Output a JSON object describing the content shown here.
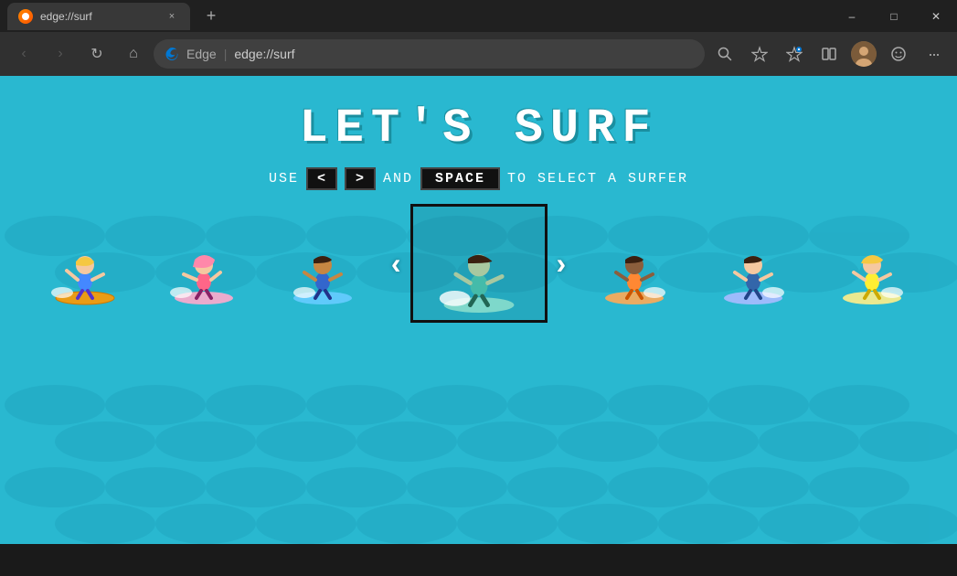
{
  "browser": {
    "tab": {
      "favicon_color": "#f60",
      "title": "edge://surf",
      "close_label": "×"
    },
    "new_tab_label": "+",
    "nav": {
      "back_label": "‹",
      "forward_label": "›",
      "refresh_label": "↺",
      "home_label": "⌂",
      "address_brand": "Edge",
      "address_separator": "|",
      "address_url": "edge://surf",
      "search_label": "🔍",
      "favorite_label": "☆",
      "collections_label": "☆",
      "split_label": "⧉",
      "profile_label": "👤",
      "emoji_label": "☺",
      "more_label": "···"
    }
  },
  "game": {
    "title": "LET'S SURF",
    "instruction": {
      "prefix": "USE",
      "left_key": "<",
      "right_key": ">",
      "middle": "AND",
      "space_key": "SPACE",
      "suffix": "TO SELECT A SURFER"
    },
    "surfers": [
      {
        "id": 1,
        "description": "blonde-girl",
        "selected": false,
        "hair": "#f5c842",
        "skin": "#f5c8a0",
        "shirt": "#4488ff",
        "pants": "#5533cc"
      },
      {
        "id": 2,
        "description": "pink-hair-girl",
        "selected": false,
        "hair": "#ff88aa",
        "skin": "#f5c8a0",
        "shirt": "#ff6688",
        "pants": "#882266"
      },
      {
        "id": 3,
        "description": "blue-shirt-girl",
        "selected": false,
        "hair": "#3a2010",
        "skin": "#c68642",
        "shirt": "#3366cc",
        "pants": "#22338a"
      },
      {
        "id": 4,
        "description": "teal-shirt-girl",
        "selected": true,
        "hair": "#3a2010",
        "skin": "#a0c8a0",
        "shirt": "#44bbaa",
        "pants": "#226655"
      },
      {
        "id": 5,
        "description": "orange-shirt-boy",
        "selected": false,
        "hair": "#3a2010",
        "skin": "#8b5e3c",
        "shirt": "#ff8833",
        "pants": "#cc5500"
      },
      {
        "id": 6,
        "description": "blue-outfit-boy",
        "selected": false,
        "hair": "#3a2010",
        "skin": "#f5c8a0",
        "shirt": "#3366aa",
        "pants": "#224488"
      },
      {
        "id": 7,
        "description": "yellow-boy",
        "selected": false,
        "hair": "#f5c842",
        "skin": "#f5c8a0",
        "shirt": "#ffee33",
        "pants": "#ccaa00"
      }
    ],
    "nav_arrow_left": "‹",
    "nav_arrow_right": "›"
  }
}
